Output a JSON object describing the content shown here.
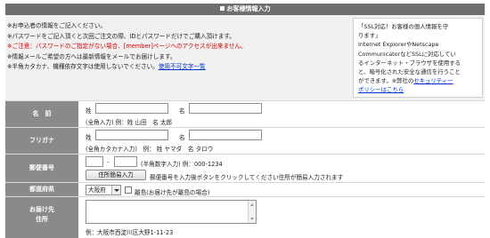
{
  "header": {
    "title": "お客様情報入力"
  },
  "notes": {
    "line1": "※お申込者の情報をご記入ください。",
    "line2": "※パスワードをご記入頂くと次回ご注文の際、IDとパスワードだけでご購入頂けます。",
    "line3": "※ご注意：パスワードのご指定がない場合、[member]ページへのアクセスが出来ません。",
    "line4": "※情報メールご希望の方へは最新情報をメールでお届けします。",
    "line5_prefix": "※半角カタカナ、機種依存文字は使用しないでください。",
    "line5_link": "使用不可文字一覧"
  },
  "ssl": {
    "l1": "「SSL対応！お客様の個人情報を守",
    "l2": "ります」",
    "l3": "Internet ExplorerやNetscape",
    "l4": "CommunicatorなどSSLに対応してい",
    "l5": "るインターネット・ブラウザを使用する",
    "l6": "と、暗号化された安全な通信を行うこと",
    "l7_prefix": "ができます。※弊社の",
    "l7_link": "セキュリティー",
    "l8_link": "ポリシーはこちら"
  },
  "form": {
    "name": {
      "label": "名　前",
      "sei": "姓",
      "mei": "名",
      "hint": "(全角入力) 例：姓 山田　名 太郎",
      "sei_value": "",
      "mei_value": ""
    },
    "furigana": {
      "label": "フリガナ",
      "sei": "姓",
      "mei": "名",
      "hint": "(全角カタカナ入力)　例：  姓 ヤマダ　名 タロウ",
      "sei_value": "",
      "mei_value": ""
    },
    "postal": {
      "label": "郵便番号",
      "dash": "-",
      "hint": "(半角数字入力) 例：000-1234",
      "button": "住所簡易入力",
      "note": "郵便番号を入力後ボタンをクリックしてください住所が簡易入力されます",
      "first_value": "",
      "second_value": ""
    },
    "prefecture": {
      "label": "都道府県",
      "selected": "大阪府",
      "remote_label": "離島(お届け先が離島の場合)"
    },
    "address": {
      "label": "お届け先",
      "label2": "住所",
      "value": "",
      "example": "例：大阪市西淀川区大野1-11-23"
    }
  }
}
